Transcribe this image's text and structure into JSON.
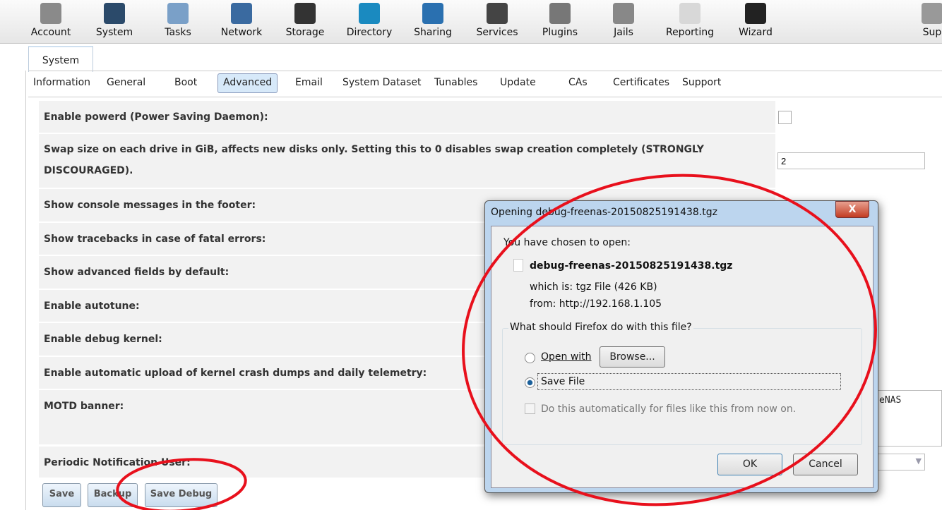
{
  "toolbar": {
    "items": [
      {
        "label": "Account",
        "color": "#8a8a8a"
      },
      {
        "label": "System",
        "color": "#2b4a6a"
      },
      {
        "label": "Tasks",
        "color": "#7aa0c8"
      },
      {
        "label": "Network",
        "color": "#3a6aa0"
      },
      {
        "label": "Storage",
        "color": "#333333"
      },
      {
        "label": "Directory",
        "color": "#1a8ac0"
      },
      {
        "label": "Sharing",
        "color": "#2a70b0"
      },
      {
        "label": "Services",
        "color": "#444444"
      },
      {
        "label": "Plugins",
        "color": "#777777"
      },
      {
        "label": "Jails",
        "color": "#888888"
      },
      {
        "label": "Reporting",
        "color": "#d8d8d8"
      },
      {
        "label": "Wizard",
        "color": "#222222"
      },
      {
        "label": "Sup",
        "color": "#999999"
      }
    ]
  },
  "tab": "System",
  "subtabs": [
    "Information",
    "General",
    "Boot",
    "Advanced",
    "Email",
    "System Dataset",
    "Tunables",
    "Update",
    "CAs",
    "Certificates",
    "Support"
  ],
  "rows": [
    "Enable powerd (Power Saving Daemon):",
    "Swap size on each drive in GiB, affects new disks only. Setting this to 0 disables swap creation completely (STRONGLY DISCOURAGED).",
    "Show console messages in the footer:",
    "Show tracebacks in case of fatal errors:",
    "Show advanced fields by default:",
    "Enable autotune:",
    "Enable debug kernel:",
    "Enable automatic upload of kernel crash dumps and daily telemetry:",
    "MOTD banner:",
    "Periodic Notification User:"
  ],
  "swap_value": "2",
  "motd_value": "eNAS",
  "buttons": {
    "save": "Save",
    "backup": "Backup",
    "save_debug": "Save Debug"
  },
  "dialog": {
    "title": "Opening debug-freenas-20150825191438.tgz",
    "close": "X",
    "chosen": "You have chosen to open:",
    "filename": "debug-freenas-20150825191438.tgz",
    "which_label": "which is:",
    "which_value": "tgz File (426 KB)",
    "from_label": "from:",
    "from_value": "http://192.168.1.105",
    "question": "What should Firefox do with this file?",
    "open_with": "Open with",
    "browse": "Browse...",
    "save_file": "Save File",
    "auto": "Do this automatically for files like this from now on.",
    "ok": "OK",
    "cancel": "Cancel"
  },
  "annotation_color": "#e8101c"
}
